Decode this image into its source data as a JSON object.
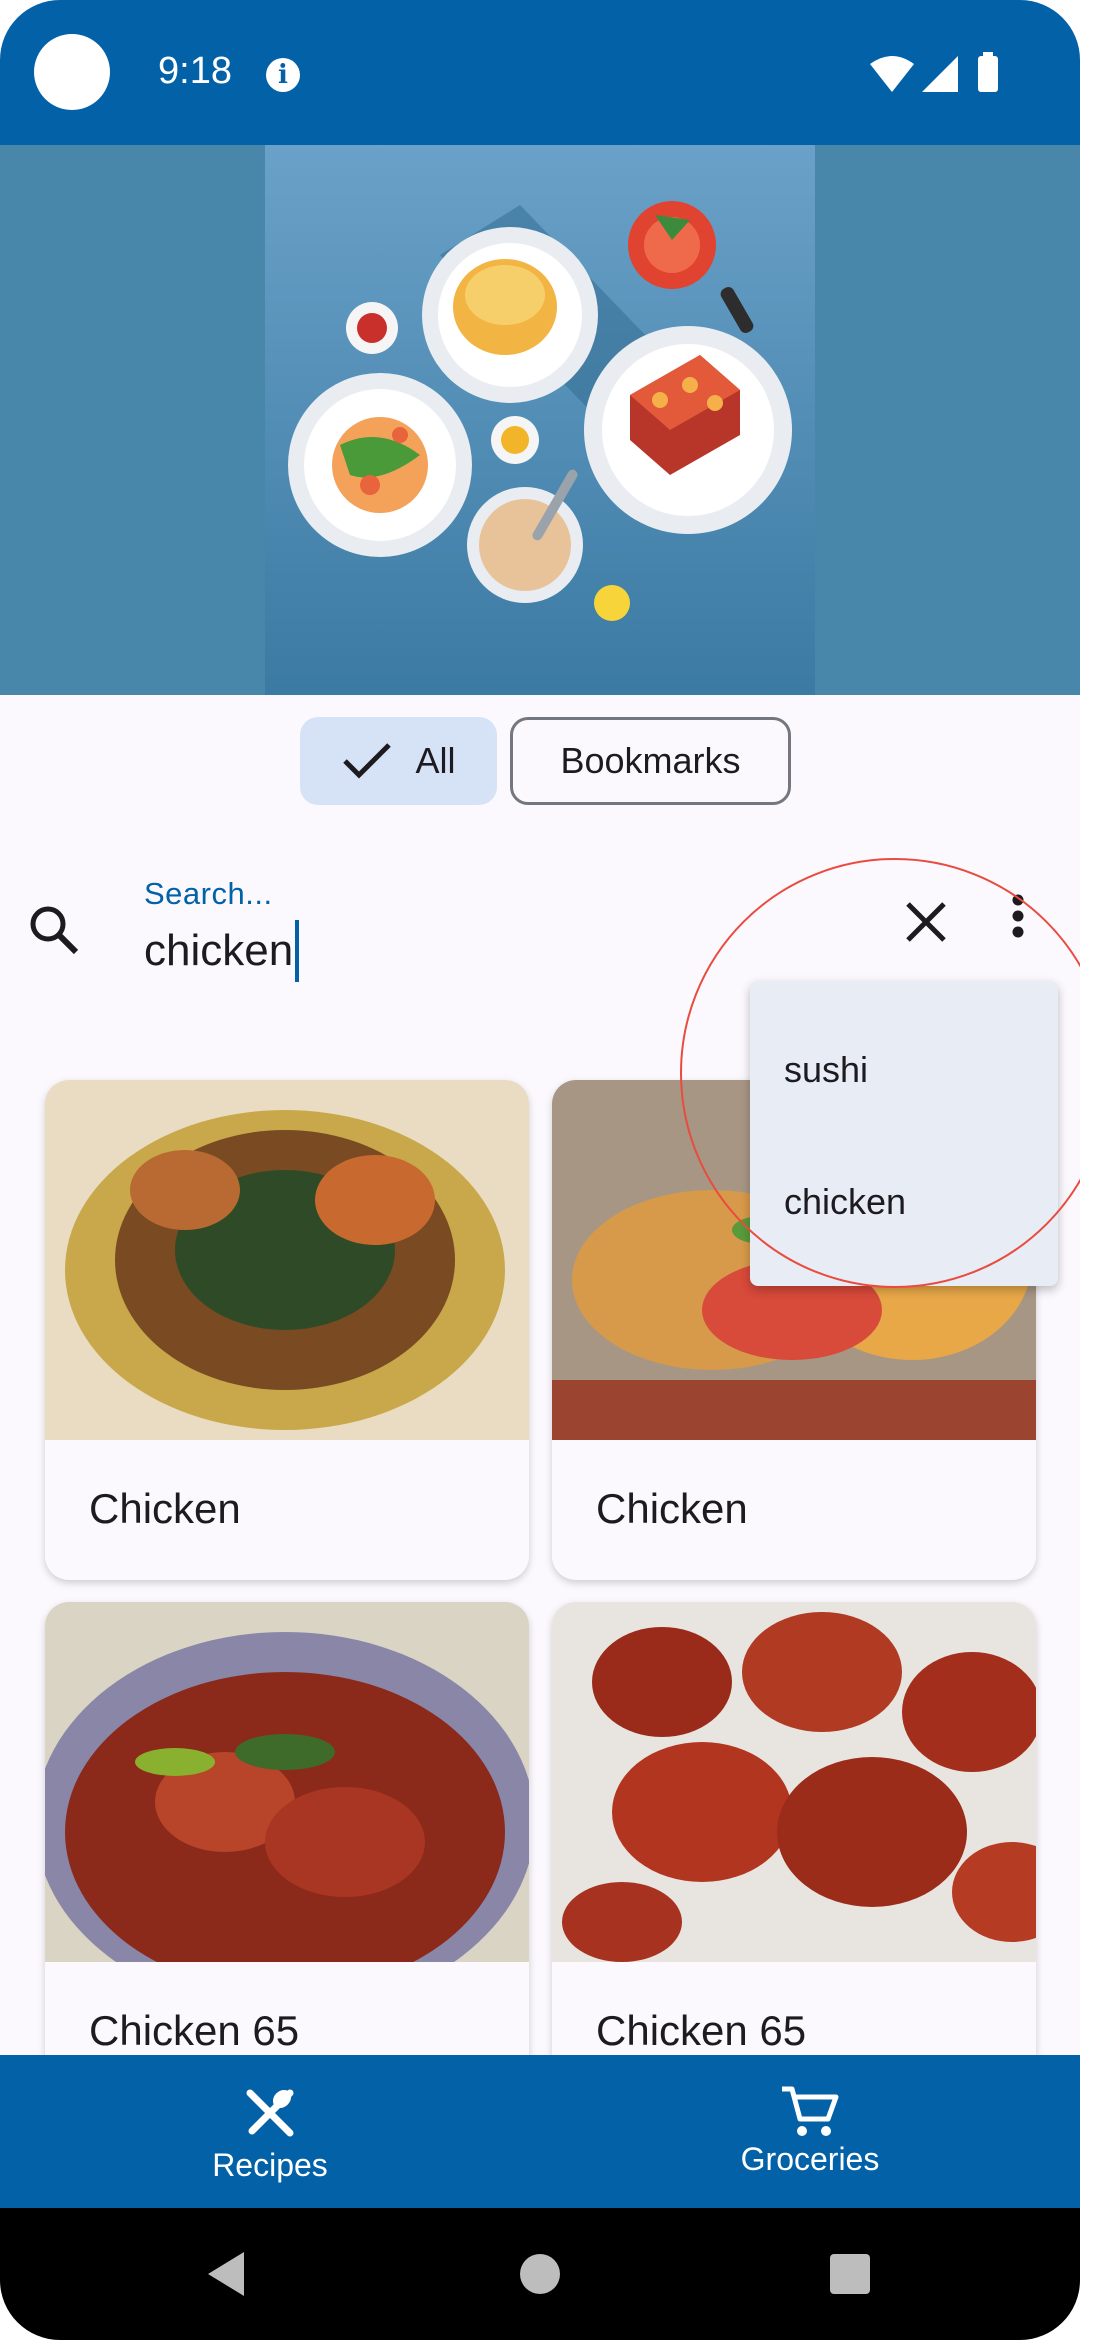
{
  "status_bar": {
    "time": "9:18",
    "info_icon": "i"
  },
  "filters": {
    "all_label": "All",
    "bookmarks_label": "Bookmarks"
  },
  "search": {
    "label": "Search...",
    "value": "chicken"
  },
  "history_menu": {
    "items": [
      "sushi",
      "chicken"
    ]
  },
  "recipes": [
    {
      "title": "Chicken"
    },
    {
      "title": "Chicken"
    },
    {
      "title": "Chicken 65"
    },
    {
      "title": "Chicken 65"
    }
  ],
  "bottom_nav": {
    "recipes_label": "Recipes",
    "groceries_label": "Groceries"
  },
  "colors": {
    "primary": "#0361a8",
    "chip_selected": "#d6e3f7",
    "menu_bg": "#e8ecf5",
    "highlight": "#ea4b3f"
  },
  "icons": [
    "info-icon",
    "wifi-icon",
    "signal-icon",
    "battery-icon",
    "check-icon",
    "search-icon",
    "close-icon",
    "more-vert-icon",
    "cutlery-icon",
    "cart-icon",
    "back-icon",
    "home-icon",
    "recents-icon"
  ]
}
